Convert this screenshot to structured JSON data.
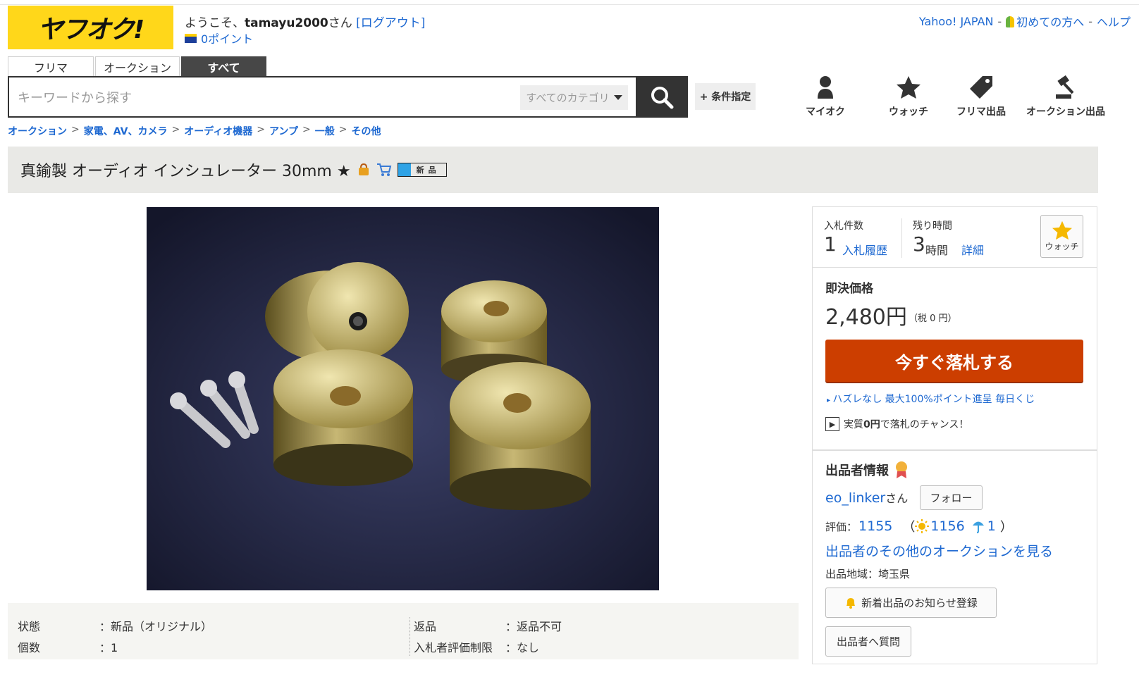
{
  "header": {
    "logo_text": "ヤフオク!",
    "welcome_prefix": "ようこそ、",
    "username": "tamayu2000",
    "welcome_suffix": "さん",
    "logout": "[ログアウト]",
    "points": "0ポイント",
    "links": [
      "Yahoo! JAPAN",
      "初めての方へ",
      "ヘルプ"
    ],
    "separator": "-"
  },
  "search": {
    "tabs": [
      "フリマ",
      "オークション",
      "すべて"
    ],
    "active_tab": "すべて",
    "placeholder": "キーワードから探す",
    "category": "すべてのカテゴリ",
    "condition_button": "+ 条件指定"
  },
  "nav_icons": [
    {
      "label": "マイオク",
      "icon": "person-icon"
    },
    {
      "label": "ウォッチ",
      "icon": "star-icon"
    },
    {
      "label": "フリマ出品",
      "icon": "tag-icon"
    },
    {
      "label": "オークション出品",
      "icon": "gavel-icon"
    }
  ],
  "breadcrumb": [
    "オークション",
    "家電、AV、カメラ",
    "オーディオ機器",
    "アンプ",
    "一般",
    "その他"
  ],
  "breadcrumb_sep": ">",
  "item": {
    "title": "真鍮製 オーディオ インシュレーター 30mm ★",
    "new_badge": "新品"
  },
  "details": {
    "condition_label": "状態",
    "condition_value": "：新品（オリジナル）",
    "quantity_label": "個数",
    "quantity_value": "：1",
    "return_label": "返品",
    "return_value": "：返品不可",
    "bidder_limit_label": "入札者評価制限",
    "bidder_limit_value": "：なし"
  },
  "sidebar": {
    "bids_label": "入札件数",
    "bids_value": "1",
    "bid_history": "入札履歴",
    "time_label": "残り時間",
    "time_value": "3",
    "time_unit": "時間",
    "time_detail": "詳細",
    "watch": "ウォッチ",
    "buy_label": "即決価格",
    "price": "2,480円",
    "tax": "（税 0 円）",
    "buy_button": "今すぐ落札する",
    "promo1": "ハズレなし 最大100%ポイント進呈 毎日くじ",
    "promo2_a": "実質",
    "promo2_b": "0円",
    "promo2_c": "で落札のチャンス！",
    "seller_heading": "出品者情報",
    "seller_name": "eo_linker",
    "seller_suffix": "さん",
    "follow": "フォロー",
    "rating_label": "評価：",
    "rating_total": "1155",
    "rating_good": "1156",
    "rating_bad": "1",
    "other_auctions": "出品者のその他のオークションを見る",
    "region": "出品地域：埼玉県",
    "notify_button": "新着出品のお知らせ登録",
    "question_button": "出品者へ質問"
  },
  "colors": {
    "logo_bg": "#ffd71a",
    "link": "#1d68d1",
    "buy_button": "#cc3e00"
  }
}
